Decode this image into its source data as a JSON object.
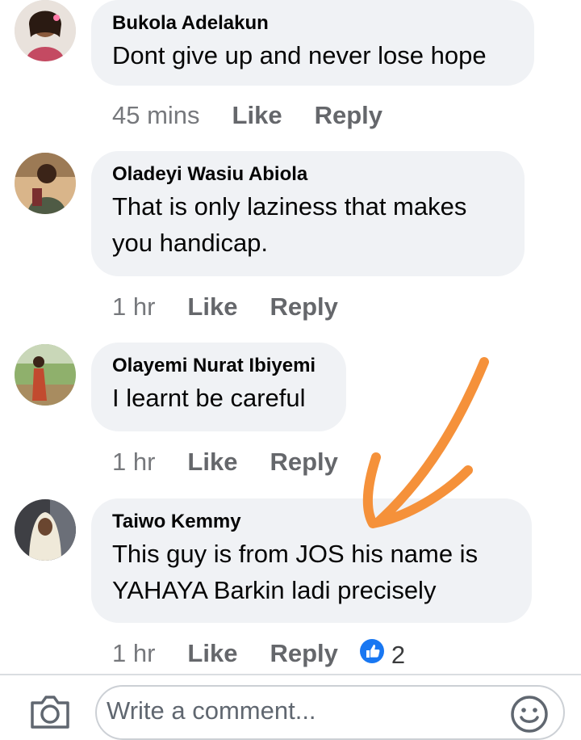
{
  "comments": [
    {
      "author": "Bukola Adelakun",
      "lines": [
        "Dont give up and never lose hope"
      ],
      "time": "45 mins",
      "like_label": "Like",
      "reply_label": "Reply"
    },
    {
      "author": "Oladeyi Wasiu Abiola",
      "lines": [
        "That is only laziness that makes",
        "you handicap."
      ],
      "time": "1 hr",
      "like_label": "Like",
      "reply_label": "Reply"
    },
    {
      "author": "Olayemi Nurat Ibiyemi",
      "lines": [
        "I learnt be careful"
      ],
      "time": "1 hr",
      "like_label": "Like",
      "reply_label": "Reply"
    },
    {
      "author": "Taiwo Kemmy",
      "lines": [
        "This guy is from JOS his name is",
        "YAHAYA Barkin ladi precisely"
      ],
      "time": "1 hr",
      "like_label": "Like",
      "reply_label": "Reply",
      "reaction_count": "2",
      "reaction_icon": "like-thumb-icon"
    }
  ],
  "composer": {
    "placeholder": "Write a comment...",
    "camera_icon": "camera-icon",
    "emoji_icon": "smiley-icon"
  },
  "colors": {
    "bubble": "#f0f2f5",
    "meta_text": "#65676b",
    "like_blue": "#1877f2",
    "annotation_arrow": "#f5913a"
  }
}
